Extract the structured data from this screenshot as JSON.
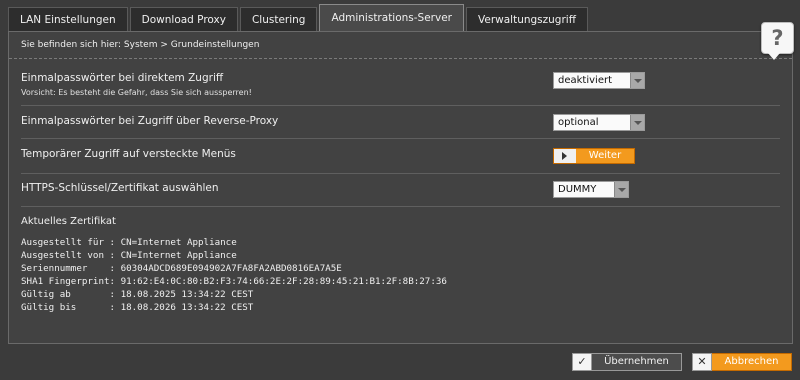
{
  "tabs": [
    {
      "label": "LAN Einstellungen"
    },
    {
      "label": "Download Proxy"
    },
    {
      "label": "Clustering"
    },
    {
      "label": "Administrations-Server",
      "active": true
    },
    {
      "label": "Verwaltungszugriff"
    }
  ],
  "breadcrumb": "Sie befinden sich hier: System > Grundeinstellungen",
  "help": {
    "glyph": "?"
  },
  "settings": {
    "otp_direct": {
      "label": "Einmalpasswörter bei direktem Zugriff",
      "note": "Vorsicht: Es besteht die Gefahr, dass Sie sich aussperren!",
      "value": "deaktiviert"
    },
    "otp_proxy": {
      "label": "Einmalpasswörter bei Zugriff über Reverse-Proxy",
      "value": "optional"
    },
    "hidden_menus": {
      "label": "Temporärer Zugriff auf versteckte Menüs",
      "button": "Weiter"
    },
    "https_cert": {
      "label": "HTTPS-Schlüssel/Zertifikat auswählen",
      "value": "DUMMY"
    }
  },
  "certificate": {
    "title": "Aktuelles Zertifikat",
    "lines": [
      "Ausgestellt für : CN=Internet Appliance",
      "Ausgestellt von : CN=Internet Appliance",
      "Seriennummer    : 60304ADCD689E094902A7FA8FA2ABD0816EA7A5E",
      "SHA1 Fingerprint: 91:62:E4:0C:80:B2:F3:74:66:2E:2F:28:89:45:21:B1:2F:8B:27:36",
      "Gültig ab       : 18.08.2025 13:34:22 CEST",
      "Gültig bis      : 18.08.2026 13:34:22 CEST"
    ]
  },
  "footer": {
    "ok_label": "Übernehmen",
    "ok_icon": "check-icon",
    "cancel_label": "Abbrechen",
    "cancel_icon": "close-icon"
  },
  "colors": {
    "accent": "#f39a1e",
    "background": "#3b3b3b",
    "panel": "#424242"
  }
}
